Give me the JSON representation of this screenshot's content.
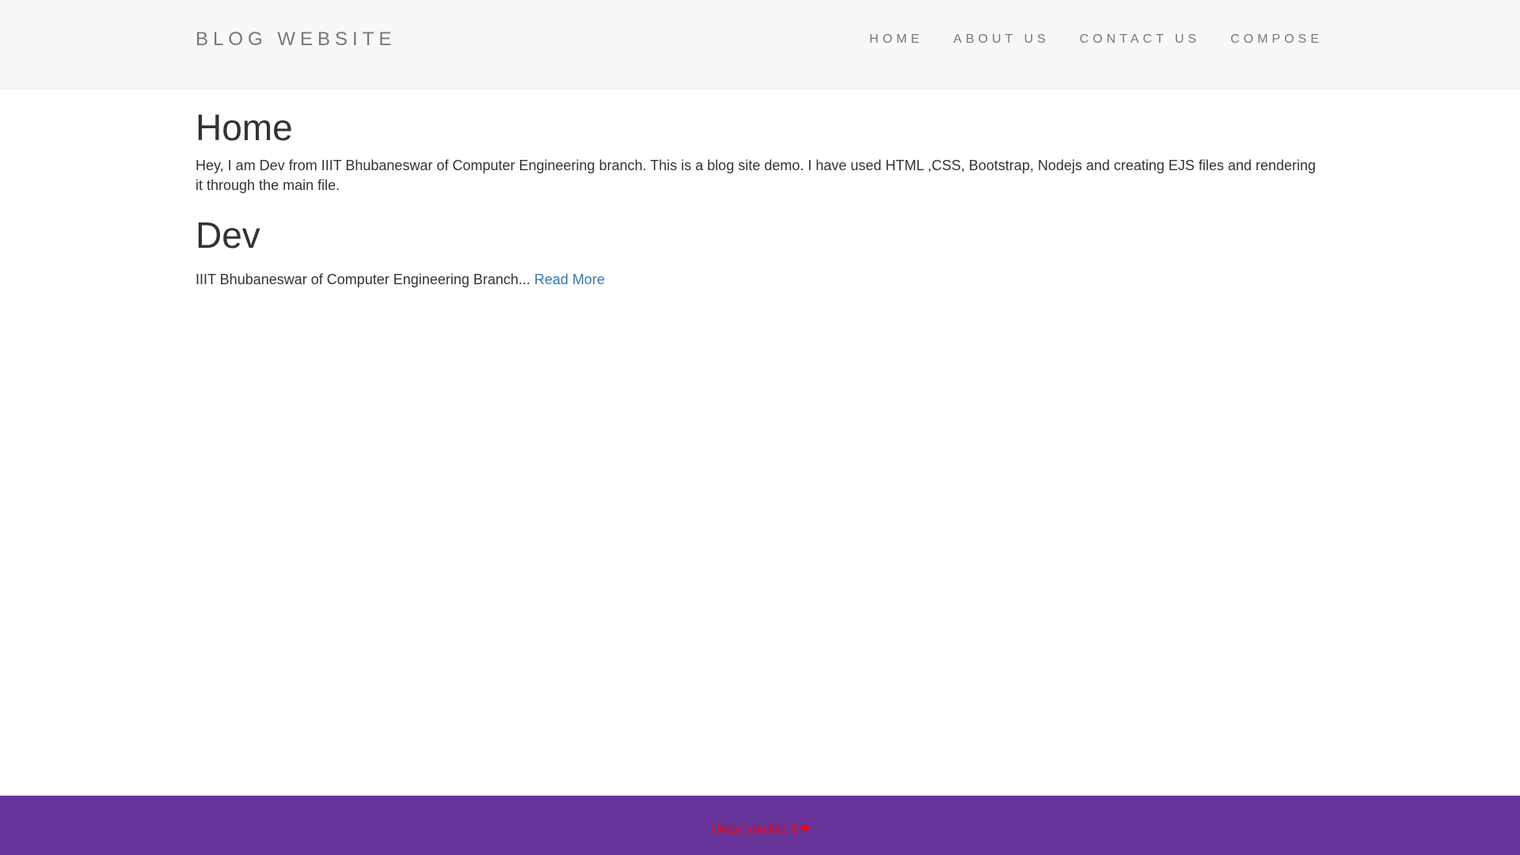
{
  "navbar": {
    "brand": "BLOG WEBSITE",
    "links": [
      "HOME",
      "ABOUT US",
      "CONTACT US",
      "COMPOSE"
    ]
  },
  "home": {
    "title": "Home",
    "intro": "Hey, I am Dev from IIIT Bhubaneswar of Computer Engineering branch. This is a blog site demo. I have used HTML ,CSS, Bootstrap, Nodejs and creating EJS files and rendering it through the main file."
  },
  "posts": [
    {
      "title": "Dev",
      "excerpt": "IIIT Bhubaneswar of Computer Engineering Branch... ",
      "read_more": "Read More"
    }
  ],
  "footer": {
    "text": "I hope you like it ",
    "heart_icon": "heart-icon"
  },
  "colors": {
    "navbar_bg": "#f8f8f8",
    "footer_bg": "#663399",
    "footer_text": "#ff0000",
    "link": "#337ab7"
  }
}
